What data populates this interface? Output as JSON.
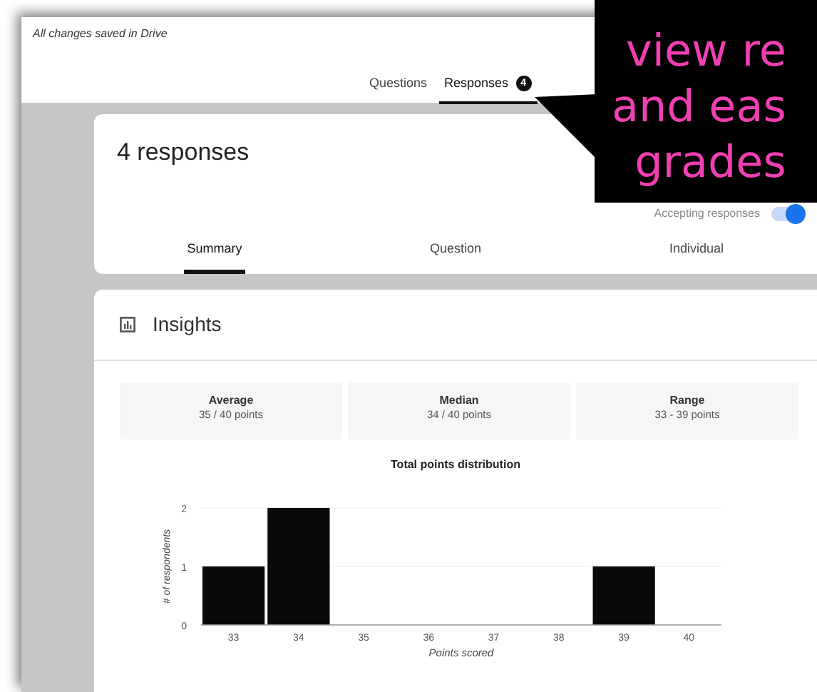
{
  "header": {
    "save_status": "All changes saved in Drive",
    "tabs": [
      {
        "label": "Questions",
        "selected": false
      },
      {
        "label": "Responses",
        "selected": true,
        "badge": "4"
      }
    ]
  },
  "responses_card": {
    "title": "4 responses",
    "accepting": {
      "label": "Accepting responses",
      "on": true
    },
    "tabs": [
      {
        "label": "Summary",
        "selected": true
      },
      {
        "label": "Question",
        "selected": false
      },
      {
        "label": "Individual",
        "selected": false
      }
    ]
  },
  "insights": {
    "title": "Insights",
    "stats": [
      {
        "label": "Average",
        "value": "35 / 40 points"
      },
      {
        "label": "Median",
        "value": "34 / 40 points"
      },
      {
        "label": "Range",
        "value": "33 - 39 points"
      }
    ],
    "chart_data": {
      "type": "bar",
      "title": "Total points distribution",
      "xlabel": "Points scored",
      "ylabel": "# of respondents",
      "categories": [
        "33",
        "34",
        "35",
        "36",
        "37",
        "38",
        "39",
        "40"
      ],
      "values": [
        1,
        2,
        0,
        0,
        0,
        0,
        1,
        0
      ],
      "ylim": [
        0,
        2
      ],
      "yticks": [
        0,
        1,
        2
      ]
    }
  },
  "callout": {
    "lines": [
      "view re",
      "and eas",
      "grades"
    ]
  }
}
